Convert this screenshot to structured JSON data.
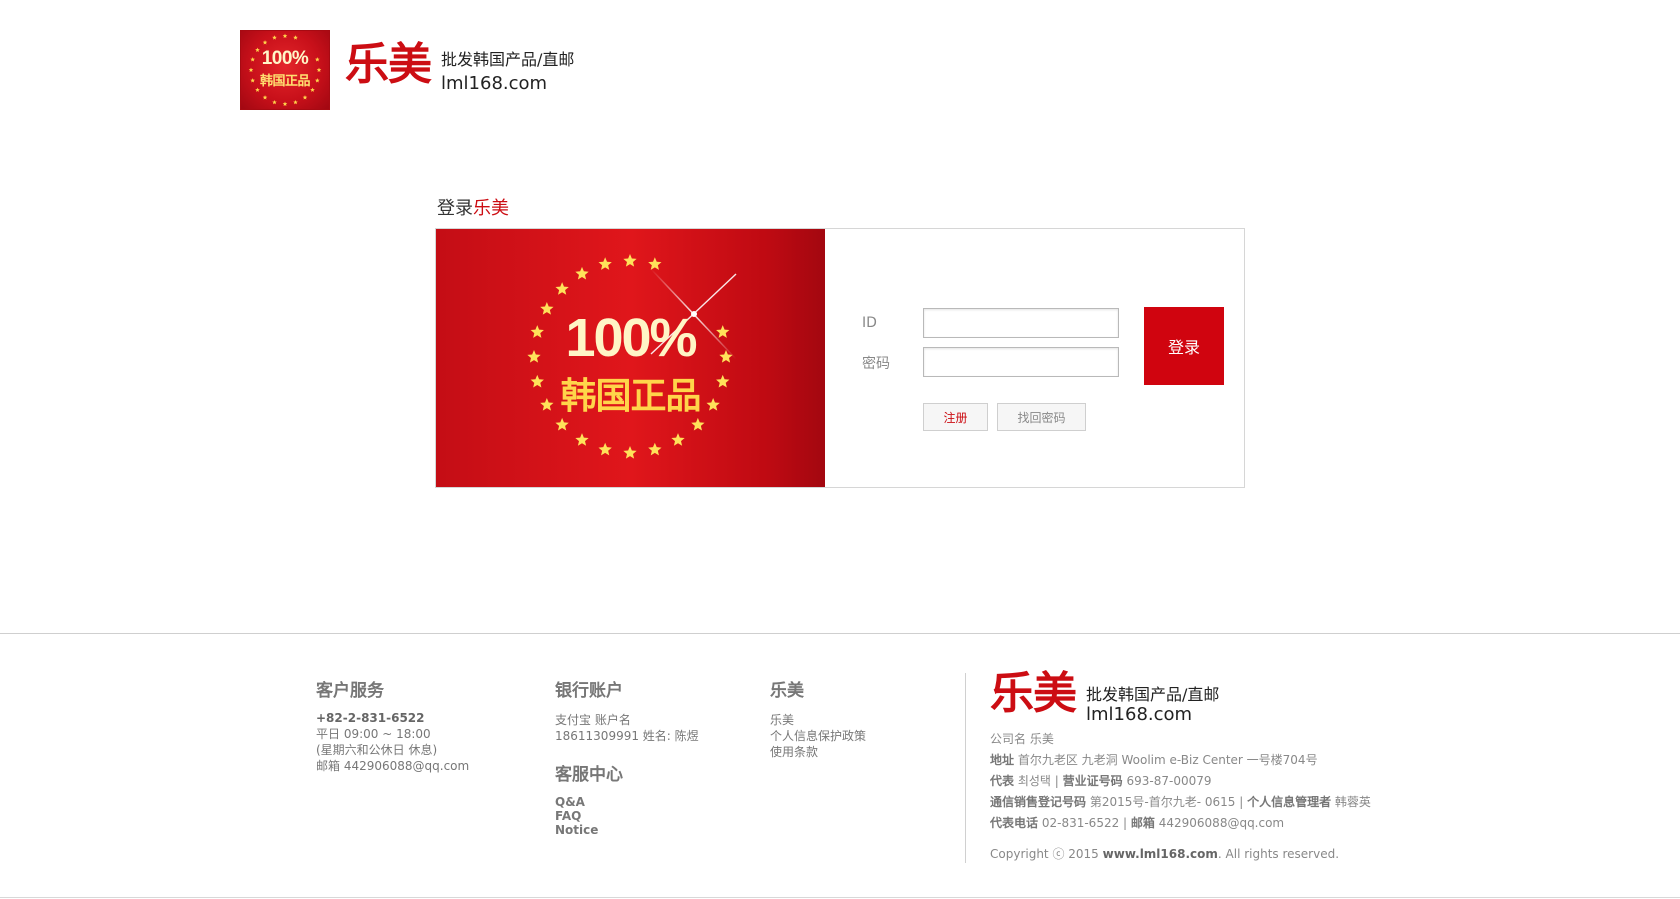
{
  "header": {
    "badge_pct": "100%",
    "badge_text": "韩国正品",
    "brand_name": "乐美",
    "brand_tagline": "批发韩国产品/直邮",
    "brand_domain": "lml168.com"
  },
  "login": {
    "title_prefix": "登录",
    "title_accent": "乐美",
    "promo_pct": "100%",
    "promo_text": "韩国正品",
    "id_label": "ID",
    "password_label": "密码",
    "id_value": "",
    "password_value": "",
    "login_button": "登录",
    "register_button": "注册",
    "recover_button": "找回密码"
  },
  "footer": {
    "customer_service": {
      "title": "客户服务",
      "phone": "+82-2-831-6522",
      "hours": "平日 09:00 ~ 18:00",
      "closed": "(星期六和公休日 休息)",
      "email": "邮箱 442906088@qq.com"
    },
    "bank": {
      "title": "银行账户",
      "line1": "支付宝 账户名",
      "line2": "18611309991 姓名: 陈煜"
    },
    "help_center": {
      "title": "客服中心",
      "links": [
        "Q&A",
        "FAQ",
        "Notice"
      ]
    },
    "lemei": {
      "title": "乐美",
      "links": [
        "乐美",
        "个人信息保护政策",
        "使用条款"
      ]
    },
    "company": {
      "brand_name": "乐美",
      "brand_tagline": "批发韩国产品/直邮",
      "brand_domain": "lml168.com",
      "name_label": "公司名",
      "name_value": "乐美",
      "address_label": "地址",
      "address_value": "首尔九老区 九老洞 Woolim e-Biz Center 一号楼704号",
      "rep_label": "代表",
      "rep_value": "최성택",
      "biz_label": "营业证号码",
      "biz_value": "693-87-00079",
      "telecom_label": "通信销售登记号码",
      "telecom_value": "第2015号-首尔九老- 0615",
      "privacy_label": "个人信息管理者",
      "privacy_value": "韩蓉英",
      "tel_label": "代表电话",
      "tel_value": "02-831-6522",
      "mail_label": "邮箱",
      "mail_value": "442906088@qq.com",
      "copyright_prefix": "Copyright ⓒ 2015",
      "copyright_site": "www.lml168.com",
      "copyright_suffix": ". All rights reserved."
    }
  }
}
